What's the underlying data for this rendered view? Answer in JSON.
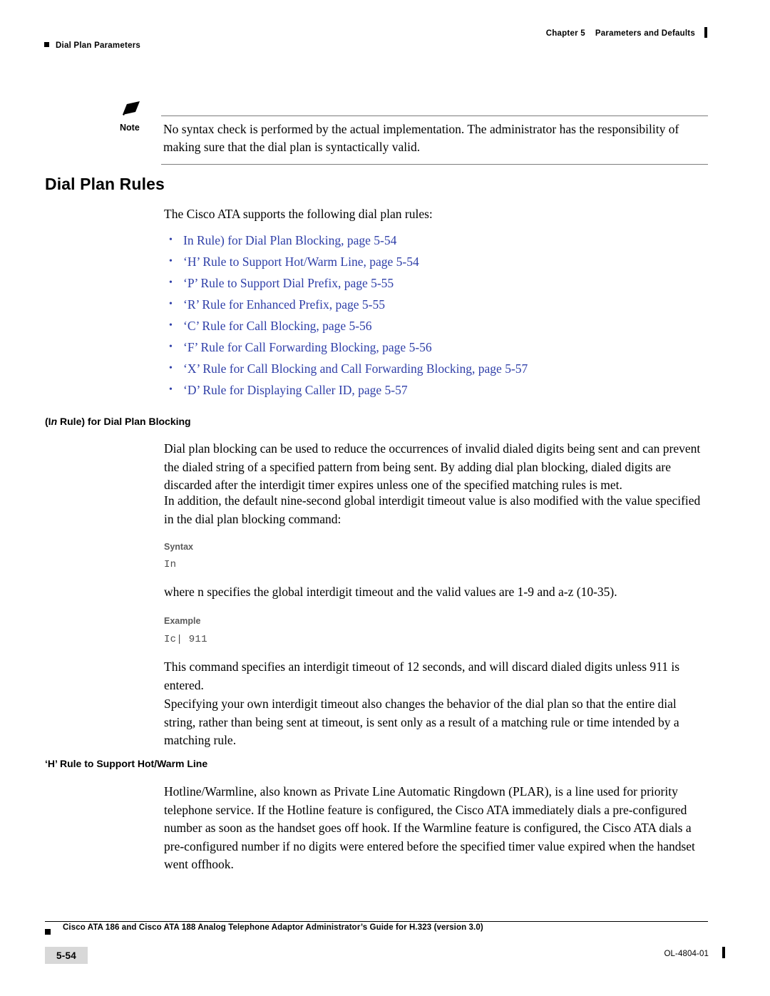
{
  "header": {
    "left_label": "Dial Plan Parameters",
    "chapter": "Chapter 5",
    "chapter_title": "Parameters and Defaults"
  },
  "note": {
    "label": "Note",
    "text": "No syntax check is performed by the actual implementation. The administrator has the responsibility of making sure that the dial plan is syntactically valid."
  },
  "section": {
    "title": "Dial Plan Rules",
    "intro": "The Cisco ATA supports the following dial plan rules:",
    "links": [
      "In Rule) for Dial Plan Blocking, page 5-54",
      "‘H’ Rule to Support Hot/Warm Line, page 5-54",
      "‘P’ Rule to Support Dial Prefix, page 5-55",
      "‘R’ Rule for Enhanced Prefix, page 5-55",
      "‘C’ Rule for Call Blocking, page 5-56",
      "‘F’ Rule for Call Forwarding Blocking, page 5-56",
      "‘X’ Rule for Call Blocking and Call Forwarding Blocking, page 5-57",
      "‘D’ Rule for Displaying Caller ID, page 5-57"
    ]
  },
  "sub1": {
    "heading_pre": "(I",
    "heading_ital": "n",
    "heading_post": " Rule) for Dial Plan Blocking",
    "para1": "Dial plan blocking can be used to reduce the occurrences of invalid dialed digits being sent and can prevent the dialed string of a specified pattern from being sent. By adding dial plan blocking, dialed digits are discarded after the interdigit timer expires unless one of the specified matching rules is met.",
    "para2": "In addition, the default nine-second global interdigit timeout value is also modified with the value specified in the dial plan blocking command:",
    "syntax_label": "Syntax",
    "syntax_code": "In",
    "where_text": "where n specifies the global interdigit timeout and the valid values are 1-9 and a-z (10-35).",
    "example_label": "Example",
    "example_code": "Ic| 911",
    "para3": "This command specifies an interdigit timeout of 12 seconds, and will discard dialed digits unless 911 is entered.",
    "para4": "Specifying your own interdigit timeout also changes the behavior of the dial plan so that the entire dial string, rather than being sent at timeout, is sent only as a result of a matching rule or time intended by a matching rule."
  },
  "sub2": {
    "heading": "‘H’ Rule to Support Hot/Warm Line",
    "para1": "Hotline/Warmline, also known as Private Line Automatic Ringdown (PLAR), is a line used for priority telephone service. If the Hotline feature is configured, the Cisco ATA immediately dials a pre-configured number as soon as the handset goes off hook. If the Warmline feature is configured, the Cisco ATA dials a pre-configured number if no digits were entered before the specified timer value expired when the handset went offhook."
  },
  "footer": {
    "text": "Cisco ATA 186 and Cisco ATA 188 Analog Telephone Adaptor Administrator’s Guide for H.323 (version 3.0)",
    "page_number": "5-54",
    "doc_id": "OL-4804-01"
  },
  "colors": {
    "link": "#2f3fa8",
    "code": "#4a4a4a",
    "label": "#5b5b5b"
  }
}
